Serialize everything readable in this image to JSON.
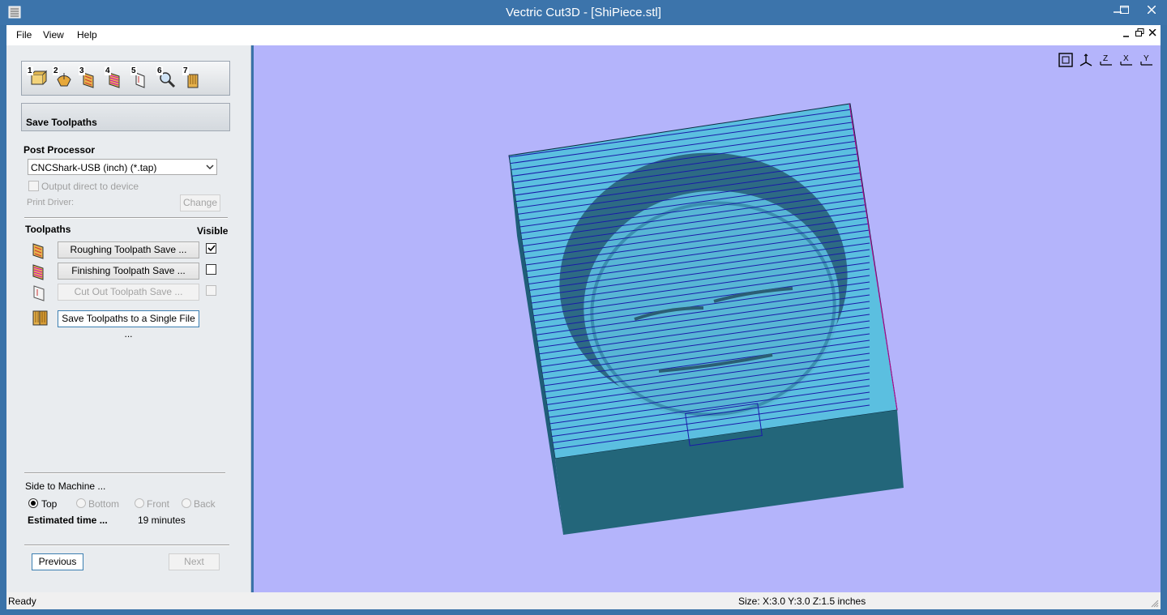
{
  "window": {
    "title": "Vectric Cut3D - [ShiPiece.stl]",
    "minimize": "minimize",
    "maximize": "maximize",
    "close": "close"
  },
  "menu": {
    "items": [
      "File",
      "View",
      "Help"
    ]
  },
  "wizard": {
    "steps": [
      {
        "num": "1",
        "icon": "load-model-icon"
      },
      {
        "num": "2",
        "icon": "orientation-icon"
      },
      {
        "num": "3",
        "icon": "roughing-icon"
      },
      {
        "num": "4",
        "icon": "finishing-icon"
      },
      {
        "num": "5",
        "icon": "cutout-icon"
      },
      {
        "num": "6",
        "icon": "preview-icon"
      },
      {
        "num": "7",
        "icon": "save-icon"
      }
    ],
    "section_title": "Save Toolpaths"
  },
  "post_processor": {
    "label": "Post Processor",
    "selected": "CNCShark-USB (inch) (*.tap)",
    "output_direct": "Output direct to device",
    "print_driver_label": "Print Driver:",
    "change_button": "Change"
  },
  "toolpaths": {
    "header": "Toolpaths",
    "visible_header": "Visible",
    "items": [
      {
        "label": "Roughing Toolpath Save ...",
        "visible": true,
        "enabled": true
      },
      {
        "label": "Finishing Toolpath Save ...",
        "visible": false,
        "enabled": true
      },
      {
        "label": "Cut Out Toolpath Save ...",
        "visible": false,
        "enabled": false
      }
    ],
    "save_single": "Save Toolpaths to a Single File ..."
  },
  "side": {
    "label": "Side to Machine ...",
    "options": [
      {
        "label": "Top",
        "selected": true,
        "enabled": true
      },
      {
        "label": "Bottom",
        "selected": false,
        "enabled": false
      },
      {
        "label": "Front",
        "selected": false,
        "enabled": false
      },
      {
        "label": "Back",
        "selected": false,
        "enabled": false
      }
    ],
    "estimated_label": "Estimated time ...",
    "estimated_value": "19 minutes"
  },
  "nav": {
    "previous": "Previous",
    "next": "Next"
  },
  "viewport_tools": [
    "fit-view-icon",
    "iso-view-icon",
    "z-axis-view-icon",
    "x-axis-view-icon",
    "y-axis-view-icon"
  ],
  "status": {
    "left": "Ready",
    "size": "Size: X:3.0 Y:3.0 Z:1.5 inches"
  }
}
